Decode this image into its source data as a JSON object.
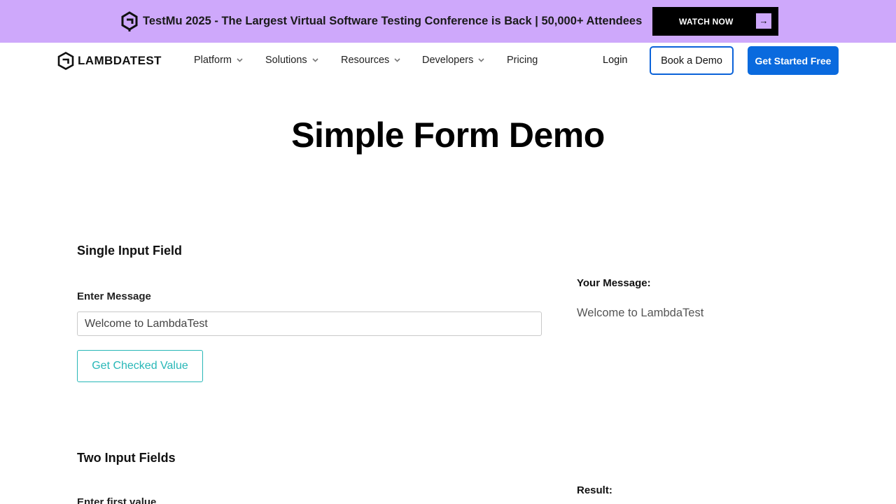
{
  "banner": {
    "text": "TestMu 2025 - The Largest Virtual Software Testing Conference is Back | 50,000+ Attendees",
    "watch_label": "WATCH NOW",
    "arrow": "→",
    "background": "#cea8fb"
  },
  "header": {
    "brand": "LAMBDATEST",
    "nav": [
      {
        "label": "Platform",
        "dropdown": true
      },
      {
        "label": "Solutions",
        "dropdown": true
      },
      {
        "label": "Resources",
        "dropdown": true
      },
      {
        "label": "Developers",
        "dropdown": true
      },
      {
        "label": "Pricing",
        "dropdown": false
      }
    ],
    "login": "Login",
    "book_demo": "Book a Demo",
    "get_started": "Get Started Free",
    "accent": "#0a6ade"
  },
  "main": {
    "title": "Simple Form Demo",
    "single": {
      "section_title": "Single Input Field",
      "label": "Enter Message",
      "input_value": "Welcome to LambdaTest",
      "button_label": "Get Checked Value",
      "output_label": "Your Message:",
      "output_value": "Welcome to LambdaTest",
      "button_color": "#27b7b7"
    },
    "two": {
      "section_title": "Two Input Fields",
      "first_label": "Enter first value",
      "result_label": "Result:"
    }
  }
}
